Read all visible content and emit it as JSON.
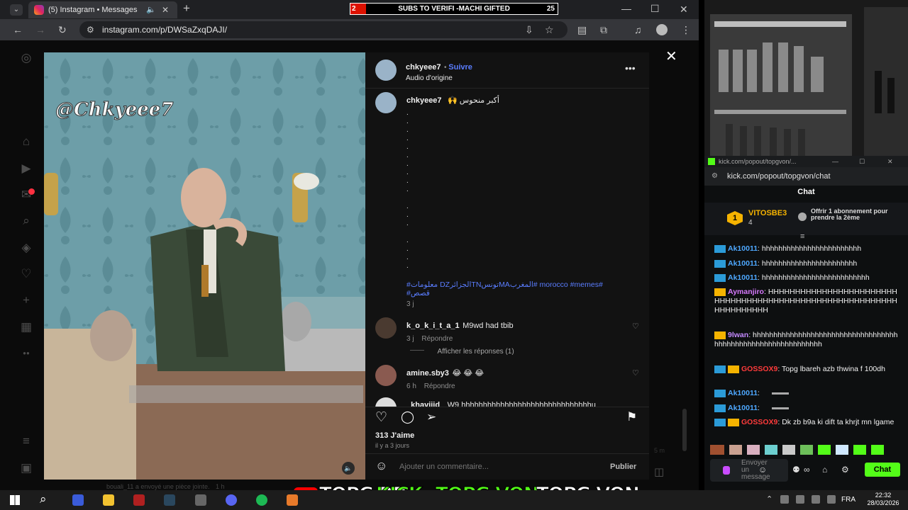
{
  "browser": {
    "tab_title": "(5) Instagram • Messages",
    "url": "instagram.com/p/DWSaZxqDAJI/",
    "new_tab": "+"
  },
  "subs_bar": {
    "left_count": "2",
    "label": "SUBS TO VERIFI -MACHI GIFTED",
    "right_count": "25"
  },
  "video": {
    "watermark": "@Chkyeee7"
  },
  "post": {
    "author": "chkyeee7",
    "follow": "Suivre",
    "audio": "Audio d'origine",
    "caption_author": "chkyeee7",
    "caption_text": "🙌 أكبر منحوس",
    "hashtags": "#معلومات DZالجزائرTNتونسMAالمغرب# morocco #memes#\n#قصص",
    "caption_time": "3 j",
    "likes": "313 J'aime",
    "time_ago": "il y a 3 jours",
    "comment_placeholder": "Ajouter un commentaire...",
    "publish": "Publier",
    "dm_notice": "bouali_11 a envoyé une pièce jointe.",
    "dm_time": "1 h",
    "side_time": "5 m"
  },
  "comments": [
    {
      "user": "k_o_k_i_t_a_1",
      "text": "M9wd had tbib",
      "time": "3 j",
      "reply": "Répondre"
    },
    {
      "user": "amine.sby3",
      "text": "😂 😂 😂",
      "time": "6 h",
      "reply": "Répondre"
    },
    {
      "user": "_khaviiid_",
      "text": "W9 hhhhhhhhhhhhhhhhhhhhhhhhhhhhhhu"
    }
  ],
  "view_replies": "Afficher les réponses (1)",
  "kick": {
    "window_title": "kick.com/popout/topgvon/...",
    "url": "kick.com/popout/topgvon/chat",
    "header": "Chat",
    "top_user": "VITOSBE3",
    "top_count": "4",
    "gift_text": "Offrir 1 abonnement pour prendre la 2ème",
    "send_placeholder": "Envoyer un message",
    "chat_button": "Chat",
    "messages": [
      {
        "user": "Ak10011",
        "text": "hhhhhhhhhhhhhhhhhhhhhhhh",
        "color": "#4ea8ff"
      },
      {
        "user": "Ak10011",
        "text": "hhhhhhhhhhhhhhhhhhhhhhh",
        "color": "#4ea8ff"
      },
      {
        "user": "Ak10011",
        "text": "hhhhhhhhhhhhhhhhhhhhhhhhhh",
        "color": "#4ea8ff"
      },
      {
        "user": "Aymanjiro",
        "text": "HHHHHHHHHHHHHHHHHHHHHHHHHHHHHHHHHHHHHHHHHHHHHHHHHHHHHHHHHHHHHHHHHHHH",
        "color": "#d87aff"
      },
      {
        "user": "9lwan",
        "text": "hhhhhhhhhhhhhhhhhhhhhhhhhhhhhhhhhhhhhhhhhhhhhhhhhhhhhhhhhhhhh",
        "color": "#c48aff"
      },
      {
        "user": "GOSSOX9",
        "text": "Topg lbareh azb thwina f 100dh",
        "color": "#ff3b3b"
      },
      {
        "user": "Ak10011",
        "text": "",
        "color": "#4ea8ff"
      },
      {
        "user": "Ak10011",
        "text": "",
        "color": "#4ea8ff"
      },
      {
        "user": "GOSSOX9",
        "text": "Dk zb b9a ki dift ta khrjt mn lgame",
        "color": "#ff3b3b"
      }
    ]
  },
  "overlay": {
    "topg_rp": "TOPG RP",
    "kick": "KICK",
    "topg_von_1": "TOPG VON",
    "topg_von_2": "TOPG VON"
  },
  "taskbar": {
    "lang": "FRA",
    "time": "22:32",
    "date": "28/03/2026"
  },
  "colors": {
    "ig_link": "#5a7dff",
    "kick_green": "#53fc18",
    "subs_red": "#dd1111"
  }
}
